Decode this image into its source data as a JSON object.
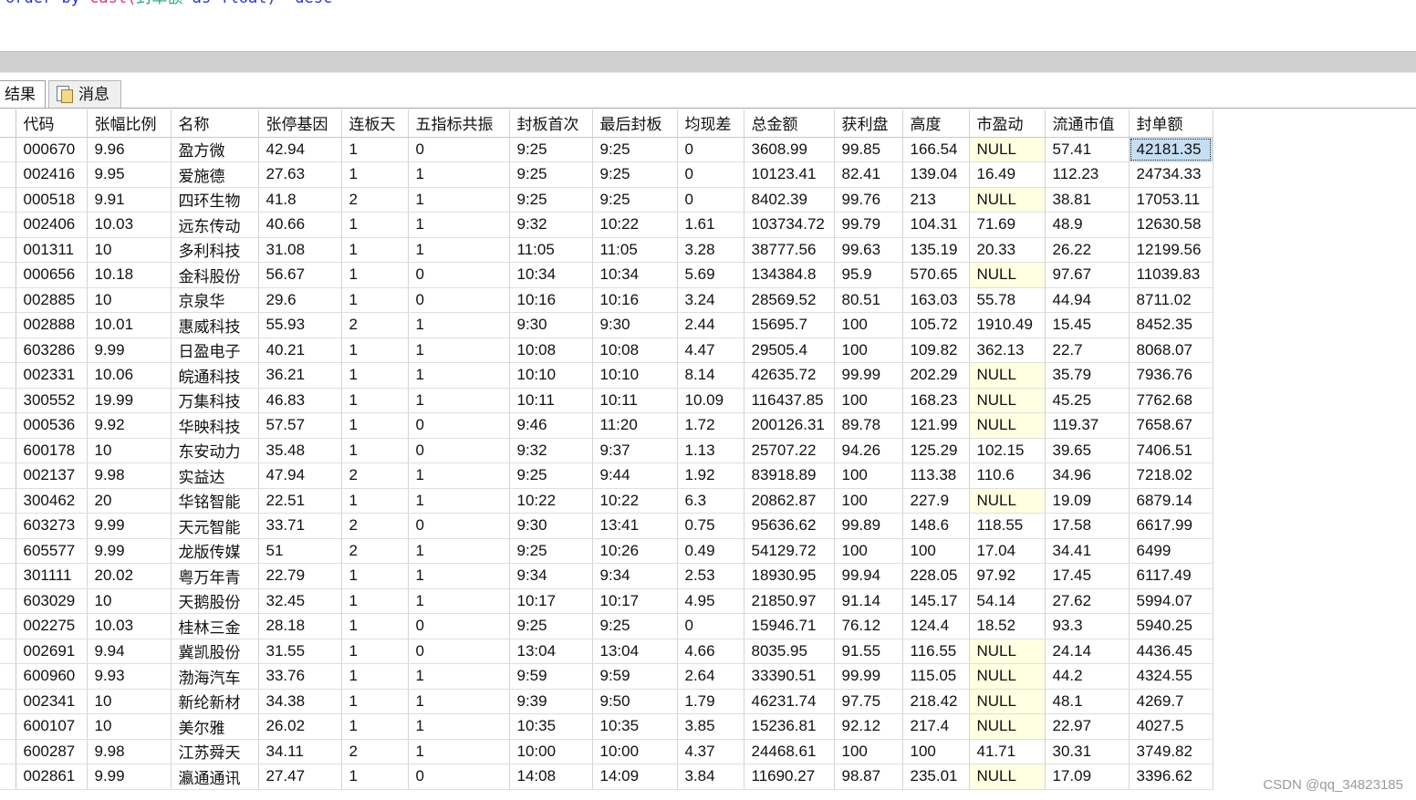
{
  "editor": {
    "sql_order": "order",
    "sql_by": "by",
    "sql_cast": "cast(",
    "sql_field": "封单额",
    "sql_as": "as",
    "sql_float": "float)",
    "sql_desc": "desc"
  },
  "tabs": [
    {
      "label": "结果",
      "active": true
    },
    {
      "label": "消息",
      "active": false,
      "icon": "messages-icon"
    }
  ],
  "grid": {
    "columns": [
      "代码",
      "张幅比例",
      "名称",
      "张停基因",
      "连板天",
      "五指标共振",
      "封板首次",
      "最后封板",
      "均现差",
      "总金额",
      "获利盘",
      "高度",
      "市盈动",
      "流通市值",
      "封单额"
    ],
    "rows": [
      [
        "000670",
        "9.96",
        "盈方微",
        "42.94",
        "1",
        "0",
        "9:25",
        "9:25",
        "0",
        "3608.99",
        "99.85",
        "166.54",
        "NULL",
        "57.41",
        "42181.35"
      ],
      [
        "002416",
        "9.95",
        "爱施德",
        "27.63",
        "1",
        "1",
        "9:25",
        "9:25",
        "0",
        "10123.41",
        "82.41",
        "139.04",
        "16.49",
        "112.23",
        "24734.33"
      ],
      [
        "000518",
        "9.91",
        "四环生物",
        "41.8",
        "2",
        "1",
        "9:25",
        "9:25",
        "0",
        "8402.39",
        "99.76",
        "213",
        "NULL",
        "38.81",
        "17053.11"
      ],
      [
        "002406",
        "10.03",
        "远东传动",
        "40.66",
        "1",
        "1",
        "9:32",
        "10:22",
        "1.61",
        "103734.72",
        "99.79",
        "104.31",
        "71.69",
        "48.9",
        "12630.58"
      ],
      [
        "001311",
        "10",
        "多利科技",
        "31.08",
        "1",
        "1",
        "11:05",
        "11:05",
        "3.28",
        "38777.56",
        "99.63",
        "135.19",
        "20.33",
        "26.22",
        "12199.56"
      ],
      [
        "000656",
        "10.18",
        "金科股份",
        "56.67",
        "1",
        "0",
        "10:34",
        "10:34",
        "5.69",
        "134384.8",
        "95.9",
        "570.65",
        "NULL",
        "97.67",
        "11039.83"
      ],
      [
        "002885",
        "10",
        "京泉华",
        "29.6",
        "1",
        "0",
        "10:16",
        "10:16",
        "3.24",
        "28569.52",
        "80.51",
        "163.03",
        "55.78",
        "44.94",
        "8711.02"
      ],
      [
        "002888",
        "10.01",
        "惠威科技",
        "55.93",
        "2",
        "1",
        "9:30",
        "9:30",
        "2.44",
        "15695.7",
        "100",
        "105.72",
        "1910.49",
        "15.45",
        "8452.35"
      ],
      [
        "603286",
        "9.99",
        "日盈电子",
        "40.21",
        "1",
        "1",
        "10:08",
        "10:08",
        "4.47",
        "29505.4",
        "100",
        "109.82",
        "362.13",
        "22.7",
        "8068.07"
      ],
      [
        "002331",
        "10.06",
        "皖通科技",
        "36.21",
        "1",
        "1",
        "10:10",
        "10:10",
        "8.14",
        "42635.72",
        "99.99",
        "202.29",
        "NULL",
        "35.79",
        "7936.76"
      ],
      [
        "300552",
        "19.99",
        "万集科技",
        "46.83",
        "1",
        "1",
        "10:11",
        "10:11",
        "10.09",
        "116437.85",
        "100",
        "168.23",
        "NULL",
        "45.25",
        "7762.68"
      ],
      [
        "000536",
        "9.92",
        "华映科技",
        "57.57",
        "1",
        "0",
        "9:46",
        "11:20",
        "1.72",
        "200126.31",
        "89.78",
        "121.99",
        "NULL",
        "119.37",
        "7658.67"
      ],
      [
        "600178",
        "10",
        "东安动力",
        "35.48",
        "1",
        "0",
        "9:32",
        "9:37",
        "1.13",
        "25707.22",
        "94.26",
        "125.29",
        "102.15",
        "39.65",
        "7406.51"
      ],
      [
        "002137",
        "9.98",
        "实益达",
        "47.94",
        "2",
        "1",
        "9:25",
        "9:44",
        "1.92",
        "83918.89",
        "100",
        "113.38",
        "110.6",
        "34.96",
        "7218.02"
      ],
      [
        "300462",
        "20",
        "华铭智能",
        "22.51",
        "1",
        "1",
        "10:22",
        "10:22",
        "6.3",
        "20862.87",
        "100",
        "227.9",
        "NULL",
        "19.09",
        "6879.14"
      ],
      [
        "603273",
        "9.99",
        "天元智能",
        "33.71",
        "2",
        "0",
        "9:30",
        "13:41",
        "0.75",
        "95636.62",
        "99.89",
        "148.6",
        "118.55",
        "17.58",
        "6617.99"
      ],
      [
        "605577",
        "9.99",
        "龙版传媒",
        "51",
        "2",
        "1",
        "9:25",
        "10:26",
        "0.49",
        "54129.72",
        "100",
        "100",
        "17.04",
        "34.41",
        "6499"
      ],
      [
        "301111",
        "20.02",
        "粤万年青",
        "22.79",
        "1",
        "1",
        "9:34",
        "9:34",
        "2.53",
        "18930.95",
        "99.94",
        "228.05",
        "97.92",
        "17.45",
        "6117.49"
      ],
      [
        "603029",
        "10",
        "天鹅股份",
        "32.45",
        "1",
        "1",
        "10:17",
        "10:17",
        "4.95",
        "21850.97",
        "91.14",
        "145.17",
        "54.14",
        "27.62",
        "5994.07"
      ],
      [
        "002275",
        "10.03",
        "桂林三金",
        "28.18",
        "1",
        "0",
        "9:25",
        "9:25",
        "0",
        "15946.71",
        "76.12",
        "124.4",
        "18.52",
        "93.3",
        "5940.25"
      ],
      [
        "002691",
        "9.94",
        "冀凯股份",
        "31.55",
        "1",
        "0",
        "13:04",
        "13:04",
        "4.66",
        "8035.95",
        "91.55",
        "116.55",
        "NULL",
        "24.14",
        "4436.45"
      ],
      [
        "600960",
        "9.93",
        "渤海汽车",
        "33.76",
        "1",
        "1",
        "9:59",
        "9:59",
        "2.64",
        "33390.51",
        "99.99",
        "115.05",
        "NULL",
        "44.2",
        "4324.55"
      ],
      [
        "002341",
        "10",
        "新纶新材",
        "34.38",
        "1",
        "1",
        "9:39",
        "9:50",
        "1.79",
        "46231.74",
        "97.75",
        "218.42",
        "NULL",
        "48.1",
        "4269.7"
      ],
      [
        "600107",
        "10",
        "美尔雅",
        "26.02",
        "1",
        "1",
        "10:35",
        "10:35",
        "3.85",
        "15236.81",
        "92.12",
        "217.4",
        "NULL",
        "22.97",
        "4027.5"
      ],
      [
        "600287",
        "9.98",
        "江苏舜天",
        "34.11",
        "2",
        "1",
        "10:00",
        "10:00",
        "4.37",
        "24468.61",
        "100",
        "100",
        "41.71",
        "30.31",
        "3749.82"
      ],
      [
        "002861",
        "9.99",
        "瀛通通讯",
        "27.47",
        "1",
        "0",
        "14:08",
        "14:09",
        "3.84",
        "11690.27",
        "98.87",
        "235.01",
        "NULL",
        "17.09",
        "3396.62"
      ]
    ]
  },
  "watermark": "CSDN @qq_34823185",
  "colors": {
    "null_cell": "#ffffe1",
    "selected_cell": "#c7ddf2"
  }
}
